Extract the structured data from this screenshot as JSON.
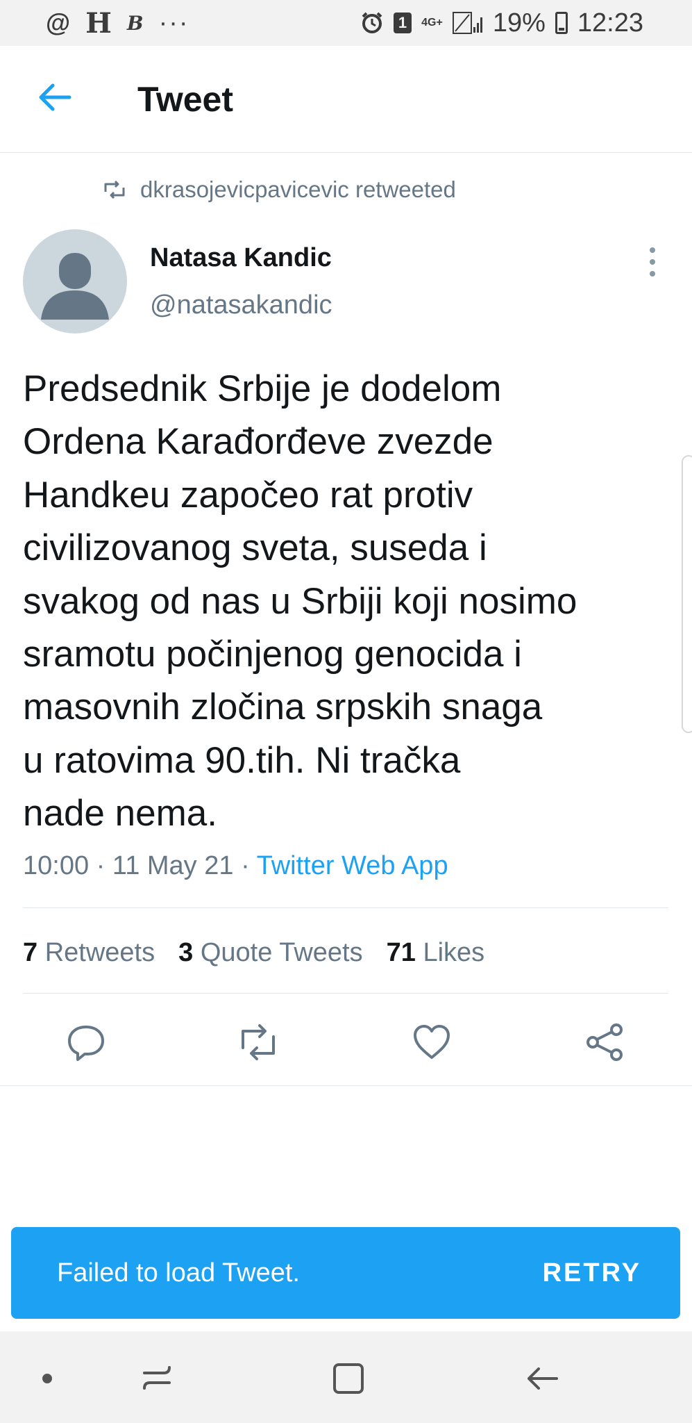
{
  "status_bar": {
    "left_icons": [
      "@",
      "H",
      "B"
    ],
    "overflow_dots": "···",
    "sim_badge": "1",
    "network": "4G+",
    "battery": "19%",
    "time": "12:23"
  },
  "header": {
    "title": "Tweet"
  },
  "retweet_context": {
    "text": "dkrasojevicpavicevic retweeted"
  },
  "author": {
    "name": "Natasa Kandic",
    "handle": "@natasakandic"
  },
  "tweet": {
    "lines": [
      "Predsednik Srbije je dodelom",
      "Ordena Karađorđeve zvezde",
      "Handkeu započeo rat protiv",
      "civilizovanog sveta, suseda i",
      "svakog od nas u Srbiji koji nosimo",
      "sramotu počinjenog genocida i",
      "masovnih zločina srpskih snaga",
      "u ratovima 90.tih. Ni tračka",
      "nade nema."
    ],
    "time": "10:00",
    "date": "11 May 21",
    "source": "Twitter Web App",
    "separator": "·"
  },
  "stats": {
    "retweets_count": "7",
    "retweets_label": "Retweets",
    "quotes_count": "3",
    "quotes_label": "Quote Tweets",
    "likes_count": "71",
    "likes_label": "Likes"
  },
  "toast": {
    "message": "Failed to load Tweet.",
    "action": "RETRY"
  },
  "colors": {
    "accent": "#1da1f2",
    "secondary_text": "#657786",
    "primary_text": "#14171a",
    "divider": "#e1e8ed"
  },
  "icons": {
    "back": "arrow-left-icon",
    "more": "more-vertical-icon",
    "reply": "reply-icon",
    "retweet": "retweet-icon",
    "like": "heart-icon",
    "share": "share-icon"
  }
}
